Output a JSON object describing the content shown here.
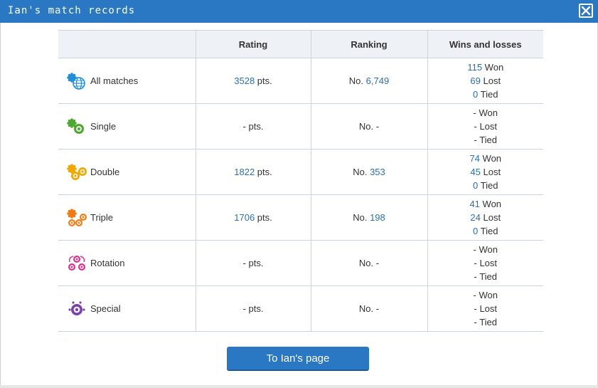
{
  "window": {
    "title": "Ian's match records"
  },
  "table": {
    "headers": [
      "",
      "Rating",
      "Ranking",
      "Wins and losses"
    ],
    "rows": [
      {
        "type": "All matches",
        "icon": "globe-gear-icon",
        "rating_value": "3528",
        "rating_unit": " pts.",
        "rank_prefix": "No. ",
        "rank_value": "6,749",
        "won": "115",
        "won_label": " Won",
        "lost": "69",
        "lost_label": " Lost",
        "tied": "0",
        "tied_label": " Tied"
      },
      {
        "type": "Single",
        "icon": "single-gear-icon",
        "rating_value": "-",
        "rating_unit": " pts.",
        "rank_prefix": "No. ",
        "rank_value": "-",
        "won": "-",
        "won_label": " Won",
        "lost": "-",
        "lost_label": " Lost",
        "tied": "-",
        "tied_label": " Tied"
      },
      {
        "type": "Double",
        "icon": "double-gear-icon",
        "rating_value": "1822",
        "rating_unit": " pts.",
        "rank_prefix": "No. ",
        "rank_value": "353",
        "won": "74",
        "won_label": " Won",
        "lost": "45",
        "lost_label": " Lost",
        "tied": "0",
        "tied_label": " Tied"
      },
      {
        "type": "Triple",
        "icon": "triple-gear-icon",
        "rating_value": "1706",
        "rating_unit": " pts.",
        "rank_prefix": "No. ",
        "rank_value": "198",
        "won": "41",
        "won_label": " Won",
        "lost": "24",
        "lost_label": " Lost",
        "tied": "0",
        "tied_label": " Tied"
      },
      {
        "type": "Rotation",
        "icon": "rotation-gear-icon",
        "rating_value": "-",
        "rating_unit": " pts.",
        "rank_prefix": "No. ",
        "rank_value": "-",
        "won": "-",
        "won_label": " Won",
        "lost": "-",
        "lost_label": " Lost",
        "tied": "-",
        "tied_label": " Tied"
      },
      {
        "type": "Special",
        "icon": "special-gear-icon",
        "rating_value": "-",
        "rating_unit": " pts.",
        "rank_prefix": "No. ",
        "rank_value": "-",
        "won": "-",
        "won_label": " Won",
        "lost": "-",
        "lost_label": " Lost",
        "tied": "-",
        "tied_label": " Tied"
      }
    ]
  },
  "button": {
    "label": "To Ian's page"
  },
  "colors": {
    "titlebar": "#2a78c4",
    "link_blue": "#2a6fb8",
    "all_matches_icon": "#1f8fd6",
    "single_icon": "#4ea830",
    "double_icon": "#f0a800",
    "triple_icon": "#f07a10",
    "rotation_icon": "#e0308a",
    "special_icon": "#7a3fb0"
  }
}
